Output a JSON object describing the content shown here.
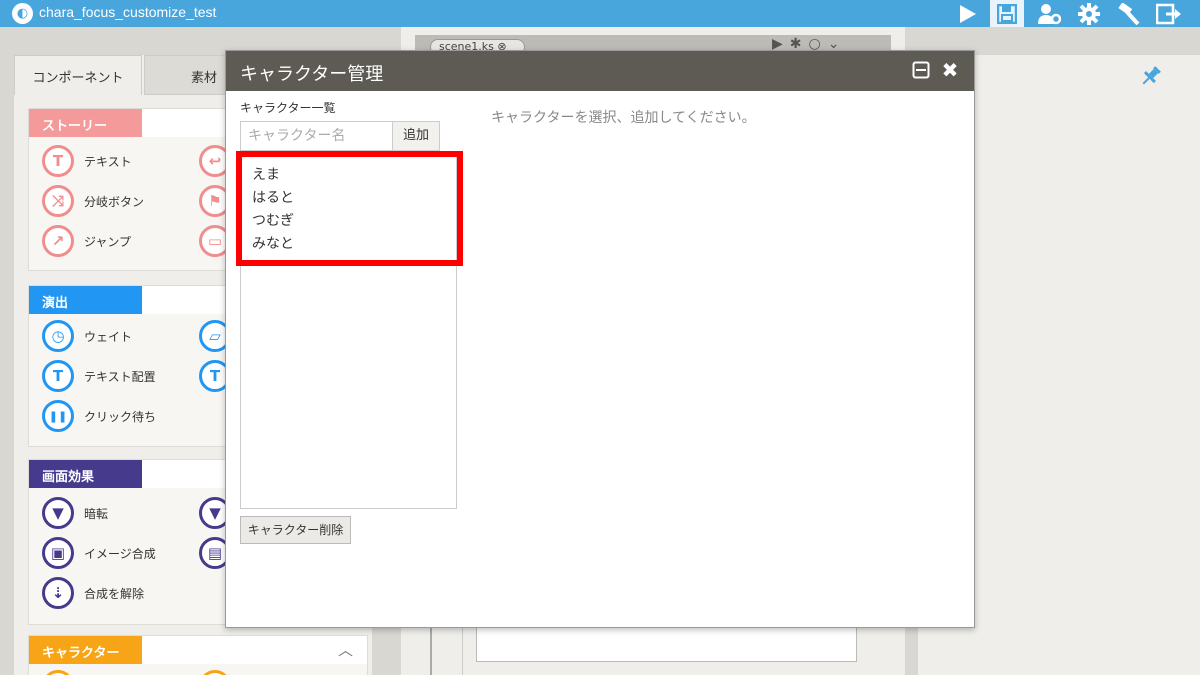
{
  "app": {
    "title": "chara_focus_customize_test",
    "logo_icon": "globe-icon"
  },
  "toolbar": [
    {
      "name": "play-icon",
      "glyph": "▶"
    },
    {
      "name": "save-icon",
      "glyph": "💾"
    },
    {
      "name": "user-settings-icon",
      "glyph": "👥"
    },
    {
      "name": "gear-icon",
      "glyph": "⚙"
    },
    {
      "name": "build-hammer-icon",
      "glyph": "🔨"
    },
    {
      "name": "export-icon",
      "glyph": "⇥"
    }
  ],
  "left_tabs": {
    "components": "コンポーネント",
    "materials": "素材"
  },
  "sections": {
    "story": {
      "label": "ストーリー",
      "items": [
        {
          "label": "テキスト",
          "icon": "text-icon",
          "glyph": "T"
        },
        {
          "label": "",
          "icon": "return-icon",
          "glyph": "↩"
        },
        {
          "label": "分岐ボタン",
          "icon": "branch-icon",
          "glyph": "⤨"
        },
        {
          "label": "",
          "icon": "flag-icon",
          "glyph": "⚑"
        },
        {
          "label": "ジャンプ",
          "icon": "jump-icon",
          "glyph": "↗"
        },
        {
          "label": "",
          "icon": "window-icon",
          "glyph": "▭"
        }
      ]
    },
    "effect": {
      "label": "演出",
      "items": [
        {
          "label": "ウェイト",
          "icon": "clock-icon",
          "glyph": "◷"
        },
        {
          "label": "",
          "icon": "quake-icon",
          "glyph": "▱"
        },
        {
          "label": "テキスト配置",
          "icon": "text-position-icon",
          "glyph": "T"
        },
        {
          "label": "",
          "icon": "text-position-icon",
          "glyph": "T"
        },
        {
          "label": "クリック待ち",
          "icon": "pause-icon",
          "glyph": "❚❚"
        }
      ]
    },
    "screen": {
      "label": "画面効果",
      "items": [
        {
          "label": "暗転",
          "icon": "blackout-icon",
          "glyph": "▼"
        },
        {
          "label": "",
          "icon": "blackout-icon",
          "glyph": "▼"
        },
        {
          "label": "イメージ合成",
          "icon": "image-icon",
          "glyph": "▣"
        },
        {
          "label": "",
          "icon": "film-icon",
          "glyph": "▤"
        },
        {
          "label": "合成を解除",
          "icon": "unblend-icon",
          "glyph": "⇣"
        }
      ]
    },
    "character": {
      "label": "キャラクター",
      "toggle_icon": "chevron-up-icon"
    }
  },
  "editor": {
    "file_tab": "scene1.ks ⊗"
  },
  "dialog": {
    "title": "キャラクター管理",
    "list_heading": "キャラクター一覧",
    "input_placeholder": "キャラクター名",
    "add_label": "追加",
    "characters": [
      "えま",
      "はると",
      "つむぎ",
      "みなと"
    ],
    "delete_label": "キャラクター削除",
    "select_message": "キャラクターを選択、追加してください。",
    "highlight_color": "#ff0000"
  },
  "colors": {
    "topbar": "#48a6dc",
    "story": "#f49a9a",
    "effect": "#2196f3",
    "screen": "#453a8b",
    "character": "#f7a516",
    "dialog_titlebar": "#5e5a54"
  }
}
